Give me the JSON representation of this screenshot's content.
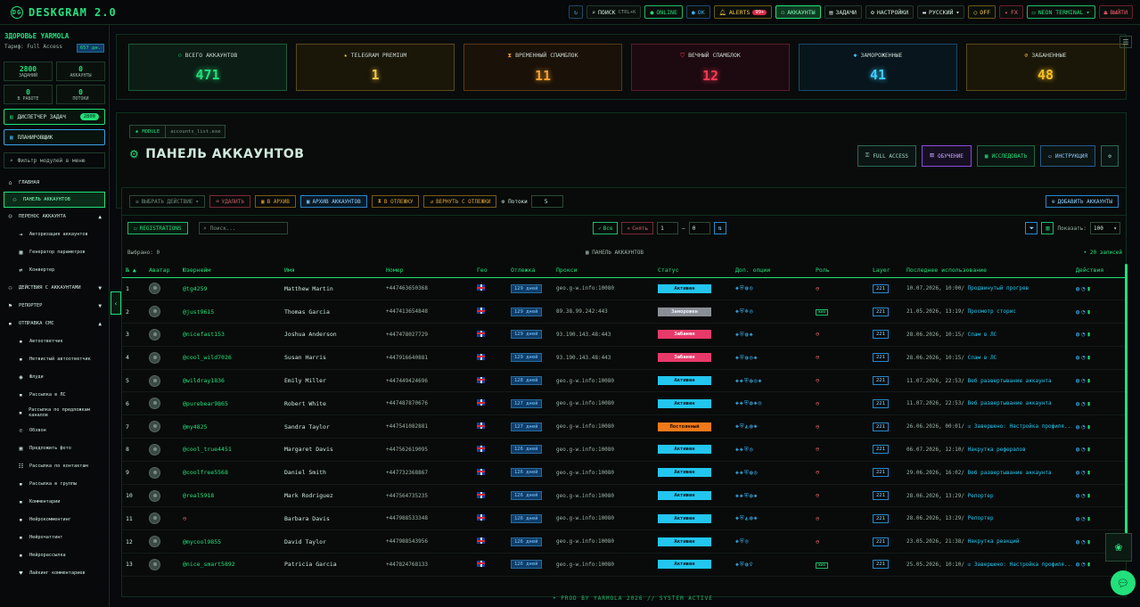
{
  "app": {
    "title": "DESKGRAM 2.0"
  },
  "topbar": {
    "search_label": "ПОИСК",
    "search_kbd": "CTRL+K",
    "online": "ONLINE",
    "ok": "OK",
    "alerts": "ALERTS",
    "alerts_count": "99+",
    "accounts": "АККАУНТЫ",
    "tasks": "ЗАДАЧИ",
    "settings": "НАСТРОЙКИ",
    "language": "РУССКИЙ",
    "off": "OFF",
    "fx": "FX",
    "theme": "NEON TERMINAL",
    "logout": "ВЫЙТИ"
  },
  "sidebar": {
    "user_name": "ЗДОРОВЬЕ YARMOLA",
    "tariff_label": "Тариф: Full Access",
    "tariff_days": "657 дн.",
    "stats": [
      {
        "value": "2800",
        "label": "ЗАДАНИЙ"
      },
      {
        "value": "0",
        "label": "АККАУНТЫ"
      },
      {
        "value": "0",
        "label": "В РАБОТЕ"
      },
      {
        "value": "0",
        "label": "ПОТОКИ"
      }
    ],
    "dispatcher_label": "ДИСПЕТЧЕР ЗАДАЧ",
    "dispatcher_count": "2800",
    "scheduler_label": "ПЛАНИРОВЩИК",
    "filter_placeholder": "Фильтр модулей в меню",
    "nav": [
      {
        "label": "ГЛАВНАЯ",
        "icon": "home-icon",
        "type": "item"
      },
      {
        "label": "ПАНЕЛЬ АККАУНТОВ",
        "icon": "users-icon",
        "type": "active"
      },
      {
        "label": "ПЕРЕНОС АККАУНТА",
        "icon": "user-icon",
        "type": "group"
      },
      {
        "label": "Авторизация аккаунтов",
        "icon": "login-icon",
        "type": "sub"
      },
      {
        "label": "Генератор параметров",
        "icon": "grid-icon",
        "type": "sub"
      },
      {
        "label": "Конвертер",
        "icon": "swap-icon",
        "type": "sub"
      },
      {
        "label": "ДЕЙСТВИЯ С АККАУНТАМИ",
        "icon": "users-icon",
        "type": "group"
      },
      {
        "label": "РЕПОРТЕР",
        "icon": "flag-icon",
        "type": "group"
      },
      {
        "label": "ОТПРАВКА СМС",
        "icon": "chat-icon",
        "type": "group"
      },
      {
        "label": "Автоответчик",
        "icon": "chat-icon",
        "type": "sub"
      },
      {
        "label": "Нетвистый автоответчик",
        "icon": "chat-icon",
        "type": "sub"
      },
      {
        "label": "Флуди",
        "icon": "eye-icon",
        "type": "sub"
      },
      {
        "label": "Рассылка в ЛС",
        "icon": "chat-icon",
        "type": "sub"
      },
      {
        "label": "Рассылка по предложкам каналов",
        "icon": "chat-icon",
        "type": "sub"
      },
      {
        "label": "Обзвон",
        "icon": "phone-icon",
        "type": "sub"
      },
      {
        "label": "Предложить фото",
        "icon": "image-icon",
        "type": "sub"
      },
      {
        "label": "Рассылка по контактам",
        "icon": "contacts-icon",
        "type": "sub"
      },
      {
        "label": "Рассылка в группы",
        "icon": "chat-icon",
        "type": "sub"
      },
      {
        "label": "Комментарии",
        "icon": "chat-icon",
        "type": "sub"
      },
      {
        "label": "Нейрокомментинг",
        "icon": "chat-icon",
        "type": "sub"
      },
      {
        "label": "Нейрочаттинг",
        "icon": "chat-icon",
        "type": "sub"
      },
      {
        "label": "Нейрорассылка",
        "icon": "chat-icon",
        "type": "sub"
      },
      {
        "label": "Лайкинг комментариев",
        "icon": "heart-icon",
        "type": "sub"
      }
    ]
  },
  "stats": [
    {
      "label": "ВСЕГО АККАУНТОВ",
      "value": "471",
      "color": "#22e07a",
      "border": "#1f5a3a",
      "bg": "#0b1d15"
    },
    {
      "label": "TELEGRAM PREMIUM",
      "value": "1",
      "color": "#f5c842",
      "border": "#5a4a18",
      "bg": "#1a1608"
    },
    {
      "label": "ВРЕМЕННЫЙ СПАМБЛОК",
      "value": "11",
      "color": "#f5a030",
      "border": "#5a3a18",
      "bg": "#1a1108"
    },
    {
      "label": "ВЕЧНЫЙ СПАМБЛОК",
      "value": "12",
      "color": "#ff3a55",
      "border": "#5a1a2a",
      "bg": "#1d0a10"
    },
    {
      "label": "ЗАМОРОЖЕННЫЕ",
      "value": "41",
      "color": "#3acfff",
      "border": "#1a4a6a",
      "bg": "#08151d"
    },
    {
      "label": "ЗАБАНЕННЫЕ",
      "value": "48",
      "color": "#f5c020",
      "border": "#5a4a18",
      "bg": "#1a1608"
    }
  ],
  "panel": {
    "module_label": "MODULE",
    "module_file": "accounts_list.exe",
    "title": "ПАНЕЛЬ АККАУНТОВ",
    "btn_full_access": "FULL ACCESS",
    "btn_learn": "ОБУЧЕНИЕ",
    "btn_research": "ИССЛЕДОВАТЬ",
    "btn_instruction": "ИНСТРУКЦИЯ"
  },
  "actions": {
    "choose": "ВЫБРАТЬ ДЕЙСТВИЕ",
    "delete": "УДАЛИТЬ",
    "to_archive": "В АРХИВ",
    "archive": "АРХИВ АККАУНТОВ",
    "to_cooldown": "В ОТЛЕЖКУ",
    "from_cooldown": "ВЕРНУТЬ С ОТЛЕЖКИ",
    "threads_label": "Потоки",
    "threads_value": "5",
    "add": "ДОБАВИТЬ АККАУНТЫ"
  },
  "filters": {
    "registrations": "REGISTRATIONS",
    "search_placeholder": "Поиск...",
    "all": "Все",
    "clear": "Снять",
    "from": "1",
    "to": "0",
    "show_label": "Показать:",
    "show_value": "100"
  },
  "selection": {
    "selected": "Выбрано: 0",
    "panel": "ПАНЕЛЬ АККАУНТОВ",
    "records": "• 20 записей"
  },
  "table": {
    "headers": [
      "№ ▲",
      "Аватар",
      "Юзернейм",
      "Имя",
      "Номер",
      "Гео",
      "Отлежка",
      "Прокси",
      "Статус",
      "Доп. опции",
      "Роль",
      "Layer",
      "Последнее использование",
      "Действия"
    ],
    "rows": [
      {
        "n": "1",
        "user": "@tg4259",
        "name": "Matthew Martin",
        "phone": "+447463650368",
        "days": "129 дней",
        "proxy": "geo.g-w.info:10080",
        "status": "Активен",
        "st": "active",
        "opts": "◈⛨◍◎",
        "role": "x",
        "layer": "221",
        "date": "10.07.2026, 10:00/",
        "last": "Продвинутый прогрев"
      },
      {
        "n": "2",
        "user": "@just9615",
        "name": "Thomas Garcia",
        "phone": "+447413654848",
        "days": "129 дней",
        "proxy": "89.38.99.242:443",
        "status": "Заморожен",
        "st": "frozen",
        "opts": "◈⛨❄◎",
        "role": "tag",
        "layer": "221",
        "date": "21.05.2026, 13:19/",
        "last": "Просмотр сторис"
      },
      {
        "n": "3",
        "user": "@nicefast153",
        "name": "Joshua Anderson",
        "phone": "+447478027729",
        "days": "129 дней",
        "proxy": "93.190.143.48:443",
        "status": "Забанен",
        "st": "banned",
        "opts": "◈⛨◍◈",
        "role": "x",
        "layer": "221",
        "date": "28.06.2026, 10:15/",
        "last": "Спам в ЛС"
      },
      {
        "n": "4",
        "user": "@cool_wild7026",
        "name": "Susan Harris",
        "phone": "+447916640881",
        "days": "129 дней",
        "proxy": "93.190.143.48:443",
        "status": "Забанен",
        "st": "banned",
        "opts": "◈⛨◍◎◈",
        "role": "x",
        "layer": "221",
        "date": "28.06.2026, 10:15/",
        "last": "Спам в ЛС"
      },
      {
        "n": "5",
        "user": "@wildray1836",
        "name": "Emily Miller",
        "phone": "+447449424696",
        "days": "128 дней",
        "proxy": "geo.g-w.info:10080",
        "status": "Активен",
        "st": "active",
        "opts": "◈◈⛨◍◎◈",
        "role": "x",
        "layer": "221",
        "date": "11.07.2026, 22:53/",
        "last": "Веб развертывание аккаунта"
      },
      {
        "n": "6",
        "user": "@purebear9865",
        "name": "Robert White",
        "phone": "+447487870676",
        "days": "127 дней",
        "proxy": "geo.g-w.info:10080",
        "status": "Активен",
        "st": "active",
        "opts": "◈◈⛨◍◈◎",
        "role": "x",
        "layer": "221",
        "date": "11.07.2026, 22:53/",
        "last": "Веб развертывание аккаунта"
      },
      {
        "n": "7",
        "user": "@my4825",
        "name": "Sandra Taylor",
        "phone": "+447541082881",
        "days": "127 дней",
        "proxy": "geo.g-w.info:10080",
        "status": "Постоянный",
        "st": "perm",
        "opts": "◈⛨◭◍◈",
        "role": "x",
        "layer": "221",
        "date": "26.06.2026, 00:01/",
        "last": "☑ Завершено: Настройка профиля..."
      },
      {
        "n": "8",
        "user": "@cool_true4451",
        "name": "Margaret Davis",
        "phone": "+447562619095",
        "days": "126 дней",
        "proxy": "geo.g-w.info:10080",
        "status": "Активен",
        "st": "active",
        "opts": "◈◈⛨◎",
        "role": "x",
        "layer": "221",
        "date": "06.07.2026, 12:10/",
        "last": "Накрутка рефералов"
      },
      {
        "n": "9",
        "user": "@coolfree5568",
        "name": "Daniel Smith",
        "phone": "+447732368867",
        "days": "126 дней",
        "proxy": "geo.g-w.info:10080",
        "status": "Активен",
        "st": "active",
        "opts": "◈◈⛨◍◎",
        "role": "x",
        "layer": "221",
        "date": "29.06.2026, 16:02/",
        "last": "Веб развертывание аккаунта"
      },
      {
        "n": "10",
        "user": "@real5918",
        "name": "Mark Rodriguez",
        "phone": "+447564735235",
        "days": "126 дней",
        "proxy": "geo.g-w.info:10080",
        "status": "Активен",
        "st": "active",
        "opts": "◈◈⛨◍◈",
        "role": "x",
        "layer": "221",
        "date": "28.06.2026, 13:29/",
        "last": "Репортер"
      },
      {
        "n": "11",
        "user": "",
        "name": "Barbara Davis",
        "phone": "+447988533348",
        "days": "126 дней",
        "proxy": "geo.g-w.info:10080",
        "status": "Активен",
        "st": "active",
        "opts": "◈⛨◭◍◈",
        "role": "x",
        "layer": "221",
        "date": "28.06.2026, 13:29/",
        "last": "Репортер"
      },
      {
        "n": "12",
        "user": "@mycool9855",
        "name": "David Taylor",
        "phone": "+447988543956",
        "days": "126 дней",
        "proxy": "geo.g-w.info:10080",
        "status": "Активен",
        "st": "active",
        "opts": "◈⛨◎",
        "role": "x",
        "layer": "221",
        "date": "23.05.2026, 21:38/",
        "last": "Накрутка реакций"
      },
      {
        "n": "13",
        "user": "@nice_smart5892",
        "name": "Patricia Garcia",
        "phone": "+447824768133",
        "days": "126 дней",
        "proxy": "geo.g-w.info:10080",
        "status": "Активен",
        "st": "active",
        "opts": "◈⛨◍♀",
        "role": "tag",
        "layer": "221",
        "date": "25.05.2026, 10:10/",
        "last": "☑ Завершено: Настройка профиля..."
      }
    ]
  },
  "footer": {
    "text": "• PROD BY YARMOLA 2026 // SYSTEM ACTIVE"
  }
}
